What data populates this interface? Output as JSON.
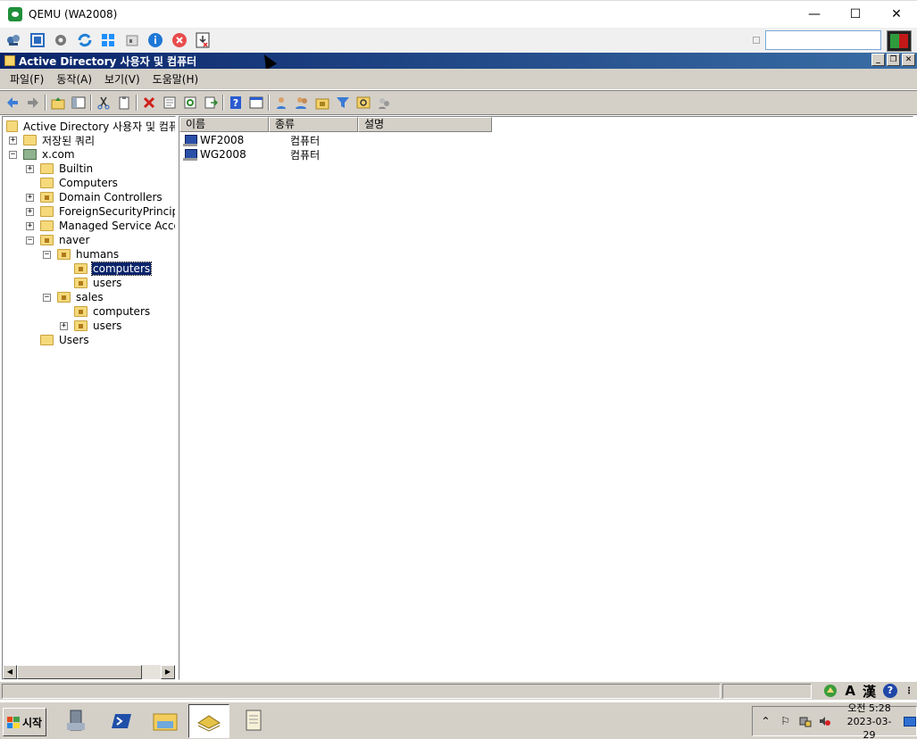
{
  "host": {
    "title": "QEMU (WA2008)",
    "controls": {
      "minimize": "—",
      "maximize": "☐",
      "close": "✕"
    },
    "toolbar_icons": [
      "network-icon",
      "fullscreen-icon",
      "settings-icon",
      "refresh-icon",
      "windows-icon",
      "usb-icon",
      "info-icon",
      "power-off-icon",
      "snapshot-icon"
    ],
    "search": {
      "value": ""
    }
  },
  "mmc": {
    "title": "Active Directory 사용자 및 컴퓨터",
    "menus": [
      "파일(F)",
      "동작(A)",
      "보기(V)",
      "도움말(H)"
    ]
  },
  "tree": {
    "root_label": "Active Directory 사용자 및 컴퓨",
    "items": [
      {
        "label": "저장된 쿼리",
        "expander": "+"
      },
      {
        "label": "x.com",
        "expander": "−"
      },
      {
        "label": "Builtin",
        "expander": "+"
      },
      {
        "label": "Computers",
        "expander": ""
      },
      {
        "label": "Domain Controllers",
        "expander": "+"
      },
      {
        "label": "ForeignSecurityPrincipa",
        "expander": "+"
      },
      {
        "label": "Managed Service Acco",
        "expander": "+"
      },
      {
        "label": "naver",
        "expander": "−"
      },
      {
        "label": "humans",
        "expander": "−"
      },
      {
        "label": "computers",
        "expander": ""
      },
      {
        "label": "users",
        "expander": ""
      },
      {
        "label": "sales",
        "expander": "−"
      },
      {
        "label": "computers",
        "expander": ""
      },
      {
        "label": "users",
        "expander": "+"
      },
      {
        "label": "Users",
        "expander": ""
      }
    ]
  },
  "list": {
    "columns": [
      "이름",
      "종류",
      "설명"
    ],
    "rows": [
      {
        "name": "WF2008",
        "type": "컴퓨터",
        "description": ""
      },
      {
        "name": "WG2008",
        "type": "컴퓨터",
        "description": ""
      }
    ]
  },
  "ime": {
    "mode": "A",
    "hanja": "漢",
    "help": "?"
  },
  "taskbar": {
    "start_label": "시작",
    "clock_time": "오전 5:28",
    "clock_date": "2023-03-29"
  }
}
